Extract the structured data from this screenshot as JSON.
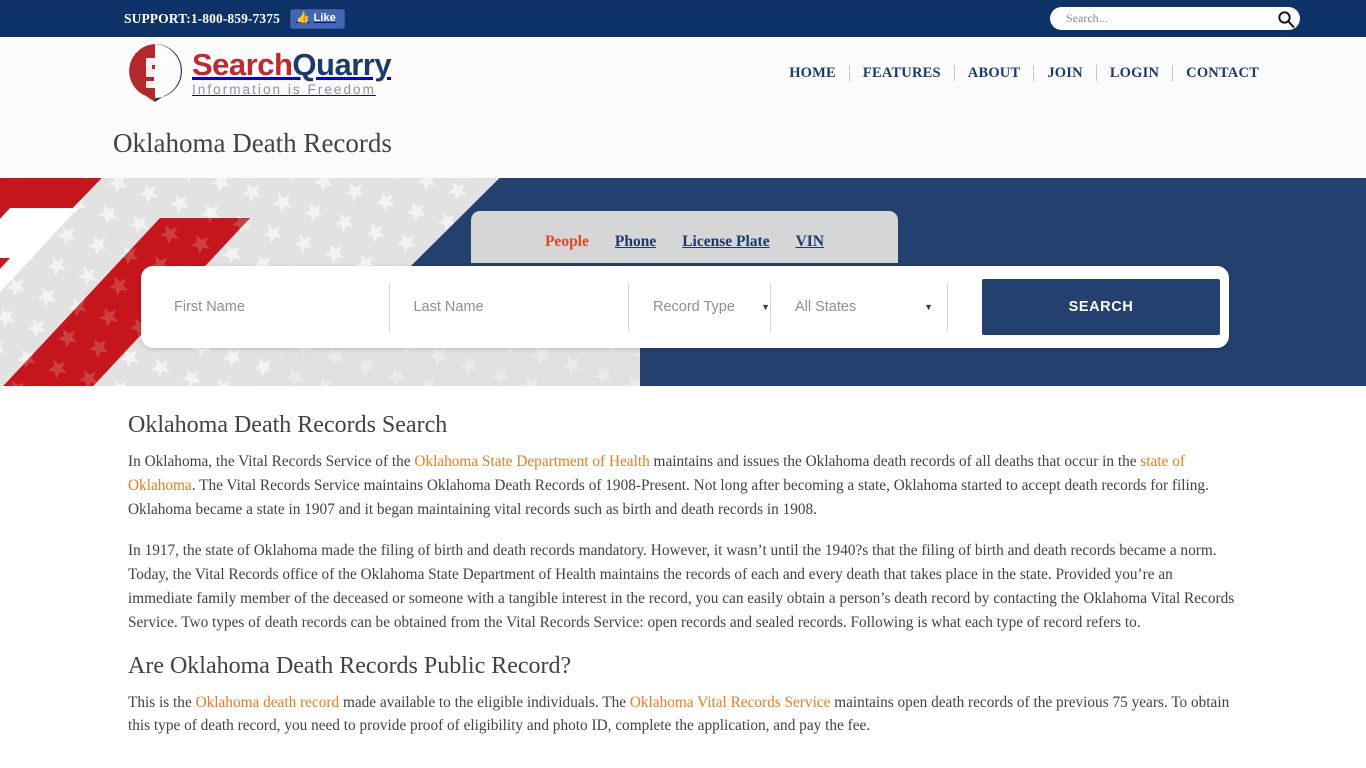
{
  "topbar": {
    "support_label": "SUPPORT:1-800-859-7375",
    "facebook_like_label": "Like",
    "facebook_thumb_icon": "thumbs-up-icon",
    "search_placeholder": "Search...",
    "search_value": "",
    "search_icon": "magnifier-icon",
    "bg_color": "#0d3268"
  },
  "header": {
    "logo_name_part1": "Search",
    "logo_name_part2": "Quarry",
    "logo_tagline": "Information is Freedom",
    "logo_icon": "searchquarry-shield-logo-icon",
    "brand_red": "#c1272d",
    "brand_navy": "#1b3a6b",
    "nav": [
      {
        "label": "HOME"
      },
      {
        "label": "FEATURES"
      },
      {
        "label": "ABOUT"
      },
      {
        "label": "JOIN"
      },
      {
        "label": "LOGIN"
      },
      {
        "label": "CONTACT"
      }
    ]
  },
  "page": {
    "title": "Oklahoma Death Records"
  },
  "hero": {
    "bg_color": "#24406f",
    "tabs": [
      {
        "label": "People",
        "active": true
      },
      {
        "label": "Phone",
        "active": false
      },
      {
        "label": "License Plate",
        "active": false
      },
      {
        "label": "VIN",
        "active": false
      }
    ],
    "form": {
      "first_name_placeholder": "First Name",
      "first_name_value": "",
      "last_name_placeholder": "Last Name",
      "last_name_value": "",
      "record_type_value": "Record Type",
      "state_value": "All States",
      "dropdown_icon": "chevron-down-icon",
      "search_button_label": "SEARCH",
      "search_button_color": "#24406f"
    }
  },
  "main": {
    "heading1": "Oklahoma Death Records Search",
    "p1": {
      "seg1": "In Oklahoma, the Vital Records Service of the ",
      "link1": "Oklahoma State Department of Health",
      "seg2": " maintains and issues the Oklahoma death records of all deaths that occur in the ",
      "link2": "state of Oklahoma",
      "seg3": ". The Vital Records Service maintains Oklahoma Death Records of 1908-Present. Not long after becoming a state, Oklahoma started to accept death records for filing. Oklahoma became a state in 1907 and it began maintaining vital records such as birth and death records in 1908."
    },
    "p2": "In 1917, the state of Oklahoma made the filing of birth and death records mandatory. However, it wasn’t until the 1940?s that the filing of birth and death records became a norm. Today, the Vital Records office of the Oklahoma State Department of Health maintains the records of each and every death that takes place in the state. Provided you’re an immediate family member of the deceased or someone with a tangible interest in the record, you can easily obtain a person’s death record by contacting the Oklahoma Vital Records Service. Two types of death records can be obtained from the Vital Records Service: open records and sealed records. Following is what each type of record refers to.",
    "heading2": "Are Oklahoma Death Records Public Record?",
    "p3": {
      "seg1": "This is the ",
      "link1": "Oklahoma death record",
      "seg2": " made available to the eligible individuals. The ",
      "link2": "Oklahoma Vital Records Service",
      "seg3": " maintains open death records of the previous 75 years. To obtain this type of death record, you need to provide proof of eligibility and photo ID, complete the application, and pay the fee."
    },
    "link_color": "#ed7a20"
  }
}
